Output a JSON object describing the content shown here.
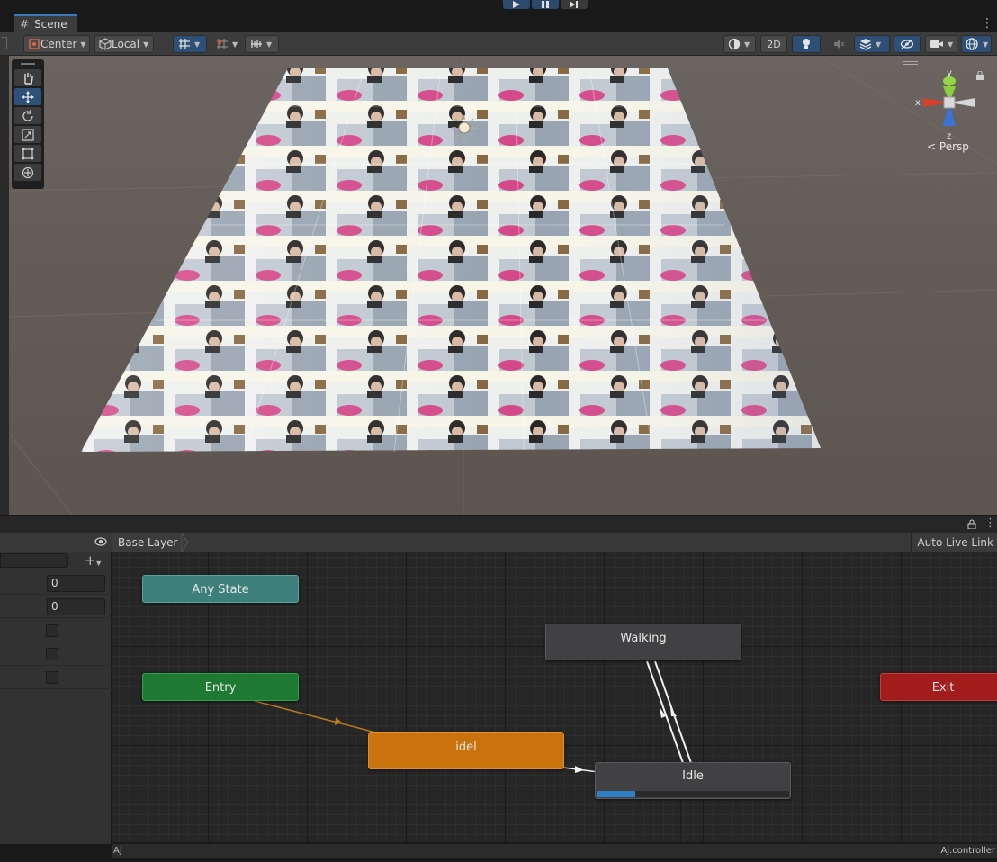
{
  "scene_tab": {
    "label": "Scene"
  },
  "toolbar": {
    "pivot_mode": "Center",
    "pivot_rotation": "Local",
    "mode_2d": "2D"
  },
  "gizmo": {
    "x": "x",
    "y": "y",
    "z": "z",
    "projection": "Persp"
  },
  "animator": {
    "layer_breadcrumb": "Base Layer",
    "auto_live_link": "Auto Live Link",
    "params": [
      {
        "kind": "number",
        "value": "0"
      },
      {
        "kind": "number",
        "value": "0"
      },
      {
        "kind": "bool"
      },
      {
        "kind": "bool"
      },
      {
        "kind": "bool"
      }
    ],
    "states": {
      "any_state": "Any State",
      "entry": "Entry",
      "exit": "Exit",
      "walking": "Walking",
      "idel": "idel",
      "idle": "Idle"
    },
    "idle_progress": 0.2,
    "footer_left": "Aj",
    "footer_right": "Aj.controller"
  },
  "colors": {
    "any_state": "#3d7f7a",
    "entry": "#1e7a33",
    "exit": "#a21c1c",
    "default_state": "#c9720e",
    "state": "#414144",
    "accent": "#3a79bb"
  }
}
